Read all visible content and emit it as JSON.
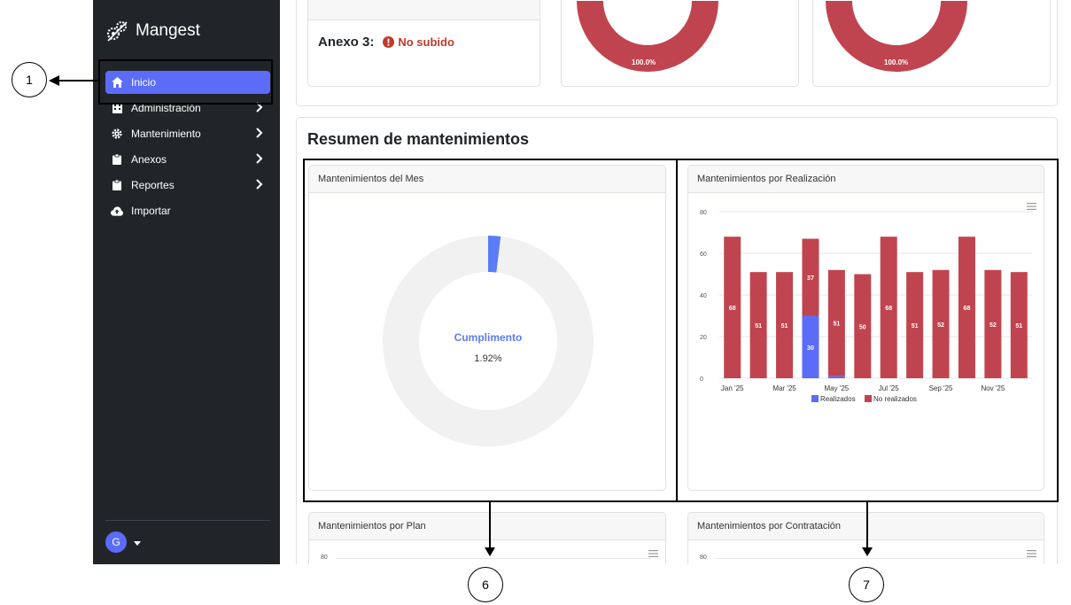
{
  "app": {
    "name": "Mangest"
  },
  "sidebar": {
    "items": [
      {
        "label": "Inicio",
        "icon": "home-icon",
        "active": true,
        "has_chevron": false
      },
      {
        "label": "Administración",
        "icon": "building-icon",
        "active": false,
        "has_chevron": true
      },
      {
        "label": "Mantenimiento",
        "icon": "gear-icon",
        "active": false,
        "has_chevron": true
      },
      {
        "label": "Anexos",
        "icon": "clipboard-icon",
        "active": false,
        "has_chevron": true
      },
      {
        "label": "Reportes",
        "icon": "clipboard-icon",
        "active": false,
        "has_chevron": true
      },
      {
        "label": "Importar",
        "icon": "cloud-upload-icon",
        "active": false,
        "has_chevron": false
      }
    ],
    "user_initial": "G"
  },
  "top": {
    "anexo_label": "Anexo 3:",
    "anexo_status": "No subido",
    "donut_a_label": "100.0%",
    "donut_b_label": "100.0%"
  },
  "section": {
    "title": "Resumen de mantenimientos"
  },
  "panels": {
    "mes": {
      "title": "Mantenimientos del Mes",
      "center_label": "Cumplimento",
      "center_value": "1.92%"
    },
    "realizacion": {
      "title": "Mantenimientos por Realización"
    },
    "plan": {
      "title": "Mantenimientos por Plan",
      "axis_top": "80"
    },
    "contratacion": {
      "title": "Mantenimientos por Contratación",
      "axis_top": "80"
    }
  },
  "callouts": {
    "c1": "1",
    "c6": "6",
    "c7": "7"
  },
  "colors": {
    "primary": "#5b6cf9",
    "danger": "#c0444f",
    "sidebar_bg": "#212529",
    "track": "#f1f1f1"
  },
  "chart_data": [
    {
      "type": "pie",
      "title": "",
      "labels": [
        "Cumplimento",
        ""
      ],
      "values": [
        1.92,
        98.08
      ],
      "colors": [
        "#5b7cf7",
        "#f1f1f1"
      ]
    },
    {
      "type": "bar",
      "stacked": true,
      "categories": [
        "Jan '25",
        "Feb '25",
        "Mar '25",
        "Apr '25",
        "May '25",
        "Jun '25",
        "Jul '25",
        "Aug '25",
        "Sep '25",
        "Oct '25",
        "Nov '25",
        "Dec '25"
      ],
      "x_tick_labels": [
        "Jan '25",
        "",
        "Mar '25",
        "",
        "May '25",
        "",
        "Jul '25",
        "",
        "Sep '25",
        "",
        "Nov '25",
        ""
      ],
      "series": [
        {
          "name": "Realizados",
          "color": "#5b6cf9",
          "values": [
            0,
            0,
            0,
            30,
            1,
            0,
            0,
            0,
            0,
            0,
            0,
            0
          ],
          "labels": [
            "",
            "",
            "",
            "30",
            "",
            "",
            "",
            "",
            "",
            "",
            "",
            ""
          ]
        },
        {
          "name": "No realizados",
          "color": "#c0444f",
          "values": [
            68,
            51,
            51,
            37,
            51,
            50,
            68,
            51,
            52,
            68,
            52,
            51
          ],
          "labels": [
            "68",
            "51",
            "51",
            "37",
            "51",
            "50",
            "68",
            "51",
            "52",
            "68",
            "52",
            "51"
          ]
        }
      ],
      "ylim": [
        0,
        80
      ],
      "yticks": [
        0,
        20,
        40,
        60,
        80
      ],
      "grid": true,
      "legend": "bottom"
    }
  ]
}
